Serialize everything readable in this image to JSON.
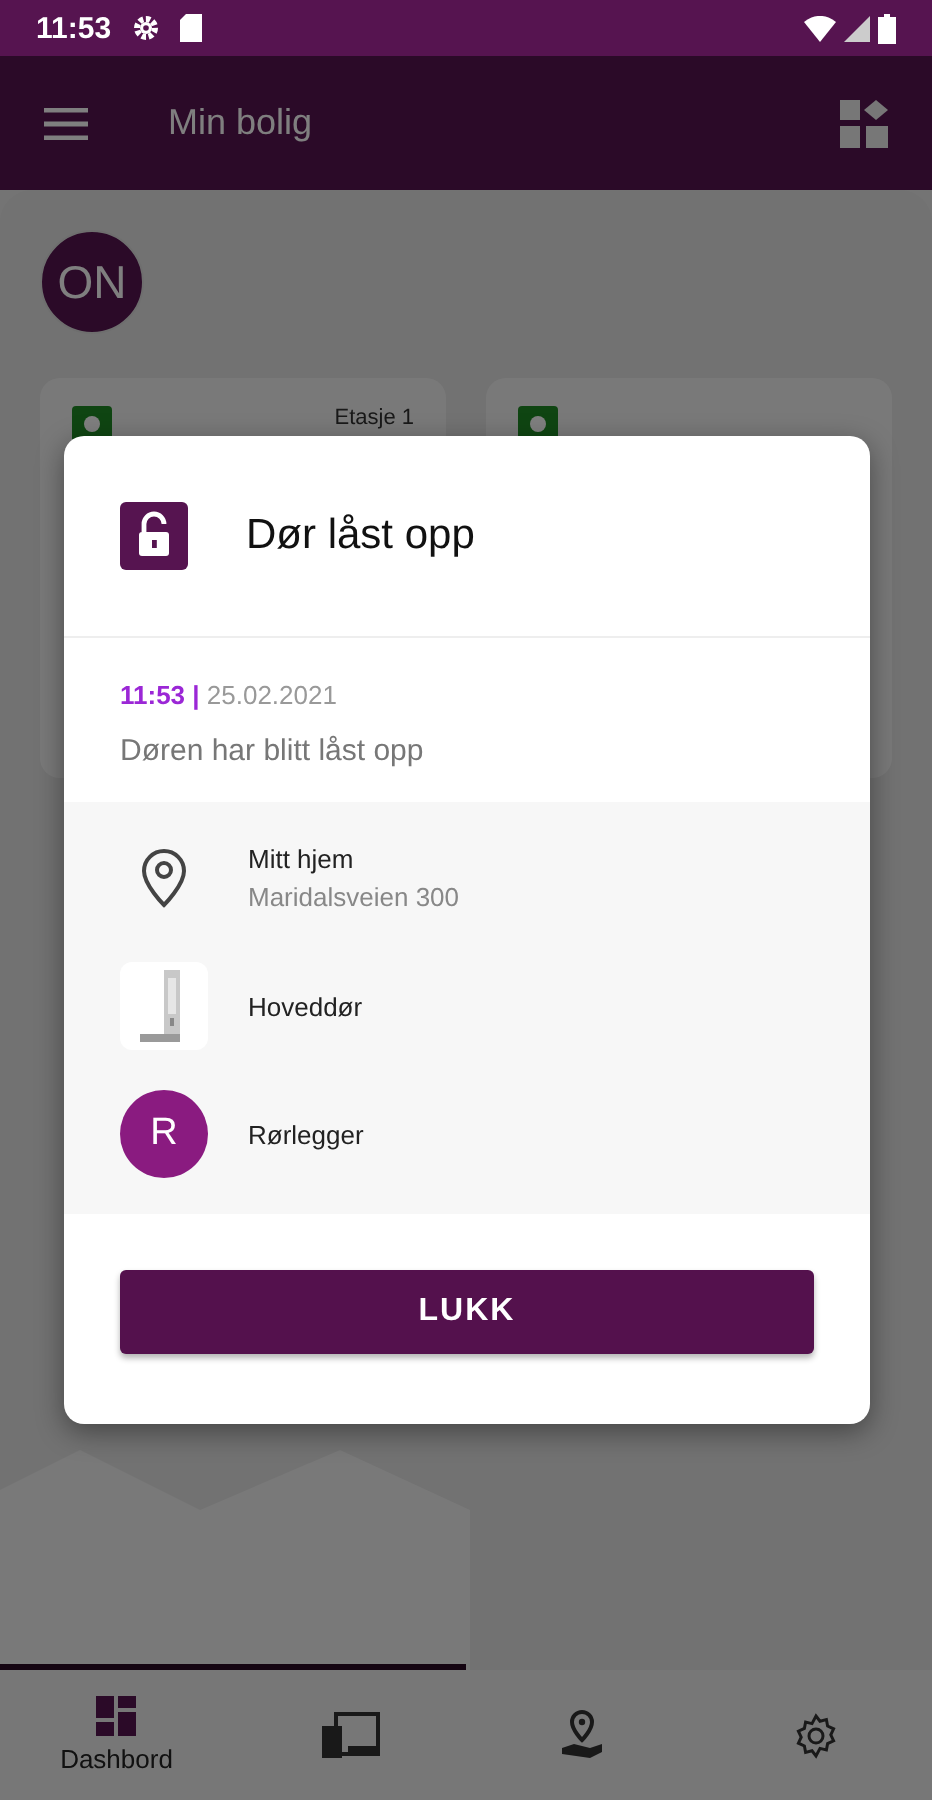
{
  "status_bar": {
    "time": "11:53"
  },
  "app_bar": {
    "title": "Min bolig"
  },
  "home": {
    "avatar": "ON",
    "cards": [
      {
        "kind": "lock",
        "label": "Etasje 1"
      },
      {
        "kind": "lock"
      }
    ]
  },
  "dialog": {
    "title": "Dør låst opp",
    "timestamp": "**11:53 |** 25.02.2021",
    "message": "Døren har blitt låst opp",
    "rows": [
      {
        "kind": "location",
        "title": "Mitt hjem",
        "subtitle": "Maridalsveien 300"
      },
      {
        "kind": "device",
        "title": "Hoveddør"
      },
      {
        "kind": "person",
        "initial": "R",
        "title": "Rørlegger"
      }
    ],
    "button": "LUKK"
  },
  "nav": [
    {
      "kind": "dashboard",
      "label": "Dashbord",
      "selected": true
    },
    {
      "kind": "devices",
      "selected": false
    },
    {
      "kind": "location",
      "selected": false
    },
    {
      "kind": "settings",
      "selected": false
    }
  ]
}
